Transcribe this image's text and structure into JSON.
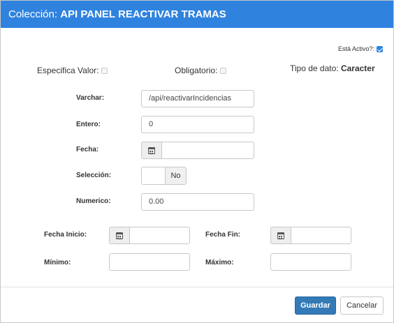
{
  "header": {
    "prefix": "Colección: ",
    "title": "API PANEL REACTIVAR TRAMAS"
  },
  "flags": {
    "activo_label": "Está Activo?:",
    "activo_checked": true,
    "especifica_label": "Especifica Valor:",
    "obligatorio_label": "Obligatorio:",
    "tipo_label": "Tipo de dato:",
    "tipo_value": "Caracter"
  },
  "fields": {
    "varchar_label": "Varchar:",
    "varchar_value": "/api/reactivarIncidencias",
    "entero_label": "Entero:",
    "entero_value": "0",
    "fecha_label": "Fecha:",
    "seleccion_label": "Selección:",
    "seleccion_value": "No",
    "numerico_label": "Numerico:",
    "numerico_value": "0.00"
  },
  "range": {
    "fecha_inicio_label": "Fecha Inicio:",
    "fecha_fin_label": "Fecha Fin:",
    "minimo_label": "Mínimo:",
    "maximo_label": "Máximo:"
  },
  "footer": {
    "guardar_label": "Guardar",
    "cancelar_label": "Cancelar"
  }
}
